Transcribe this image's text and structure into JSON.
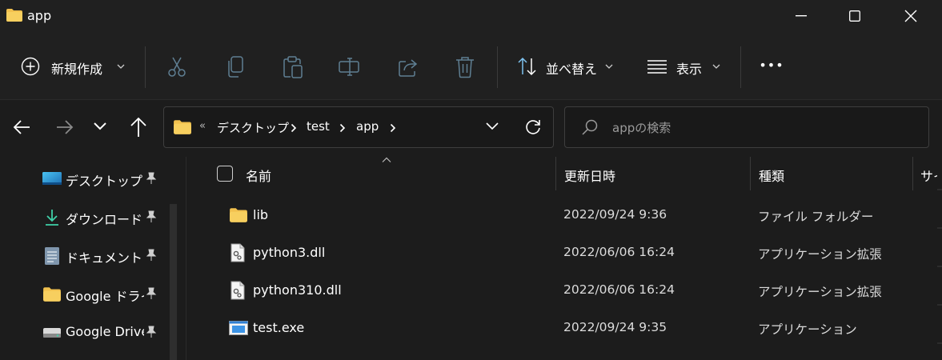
{
  "window": {
    "title": "app",
    "colors": {
      "bg": "#1c1c1c",
      "toolbar": "#202020",
      "folder": "#f2c14e"
    }
  },
  "toolbar": {
    "new_label": "新規作成",
    "sort_label": "並べ替え",
    "view_label": "表示",
    "more_label": "•••"
  },
  "address": {
    "prefix": "«",
    "crumbs": [
      "デスクトップ",
      "test",
      "app"
    ]
  },
  "search": {
    "placeholder": "appの検索"
  },
  "sidebar": {
    "items": [
      {
        "label": "デスクトップ",
        "icon": "desktop-icon"
      },
      {
        "label": "ダウンロード",
        "icon": "download-icon"
      },
      {
        "label": "ドキュメント",
        "icon": "document-icon"
      },
      {
        "label": "Google ドライブ",
        "icon": "folder-icon"
      },
      {
        "label": "Google Drive",
        "icon": "drive-icon"
      }
    ]
  },
  "list": {
    "columns": {
      "name": "名前",
      "modified": "更新日時",
      "type": "種類",
      "size": "サイズ"
    },
    "rows": [
      {
        "name": "lib",
        "modified": "2022/09/24 9:36",
        "type": "ファイル フォルダー",
        "icon": "folder-icon"
      },
      {
        "name": "python3.dll",
        "modified": "2022/06/06 16:24",
        "type": "アプリケーション拡張",
        "icon": "dll-file-icon"
      },
      {
        "name": "python310.dll",
        "modified": "2022/06/06 16:24",
        "type": "アプリケーション拡張",
        "icon": "dll-file-icon"
      },
      {
        "name": "test.exe",
        "modified": "2022/09/24 9:35",
        "type": "アプリケーション",
        "icon": "exe-file-icon"
      }
    ]
  }
}
